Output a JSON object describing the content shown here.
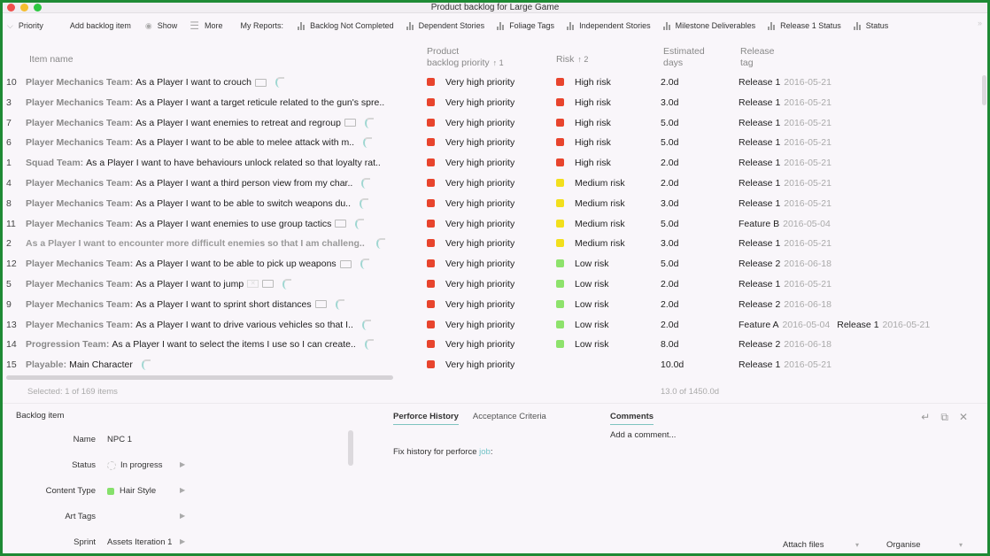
{
  "window": {
    "title": "Product backlog for Large Game"
  },
  "toolbar": {
    "priority_label": "Priority",
    "add_label": "Add backlog item",
    "show_label": "Show",
    "more_label": "More",
    "reports_label": "My Reports:",
    "reports": [
      "Backlog Not Completed",
      "Dependent Stories",
      "Foliage Tags",
      "Independent Stories",
      "Milestone Deliverables",
      "Release 1 Status",
      "Status"
    ],
    "overflow_icon": "double-chevron-right-icon"
  },
  "table": {
    "columns": {
      "name": "Item name",
      "priority_line1": "Product",
      "priority_line2": "backlog priority",
      "priority_sort": "↑ 1",
      "risk": "Risk",
      "risk_sort": "↑ 2",
      "days_line1": "Estimated",
      "days_line2": "days",
      "release_line1": "Release",
      "release_line2": "tag"
    },
    "colors": {
      "very_high": "#e8442d",
      "high_risk": "#e8442d",
      "medium_risk": "#f2df1d",
      "low_risk": "#8ee26c"
    },
    "rows": [
      {
        "num": "10",
        "team": "Player Mechanics Team:",
        "text": "As a Player I want to crouch",
        "icons": [
          "comment",
          "spinner"
        ],
        "priority": "Very high priority",
        "risk": "High risk",
        "risk_level": "high",
        "days": "2.0d",
        "releases": [
          {
            "tag": "Release 1",
            "date": "2016-05-21"
          }
        ]
      },
      {
        "num": "3",
        "team": "Player Mechanics Team:",
        "text": "As a Player I want a target reticule related to the gun's spre..",
        "icons": [],
        "priority": "Very high priority",
        "risk": "High risk",
        "risk_level": "high",
        "days": "3.0d",
        "releases": [
          {
            "tag": "Release 1",
            "date": "2016-05-21"
          }
        ]
      },
      {
        "num": "7",
        "team": "Player Mechanics Team:",
        "text": "As a Player I want enemies to retreat and regroup",
        "icons": [
          "comment",
          "spinner"
        ],
        "priority": "Very high priority",
        "risk": "High risk",
        "risk_level": "high",
        "days": "5.0d",
        "releases": [
          {
            "tag": "Release 1",
            "date": "2016-05-21"
          }
        ]
      },
      {
        "num": "6",
        "team": "Player Mechanics Team:",
        "text": "As a Player I want to be able to melee attack with m..",
        "icons": [
          "spinner"
        ],
        "priority": "Very high priority",
        "risk": "High risk",
        "risk_level": "high",
        "days": "5.0d",
        "releases": [
          {
            "tag": "Release 1",
            "date": "2016-05-21"
          }
        ]
      },
      {
        "num": "1",
        "team": "Squad Team:",
        "text": "As a Player I want to have behaviours unlock related so that loyalty rat..",
        "icons": [],
        "priority": "Very high priority",
        "risk": "High risk",
        "risk_level": "high",
        "days": "2.0d",
        "releases": [
          {
            "tag": "Release 1",
            "date": "2016-05-21"
          }
        ]
      },
      {
        "num": "4",
        "team": "Player Mechanics Team:",
        "text": "As a Player I want a third person view from my char..",
        "icons": [
          "spinner"
        ],
        "priority": "Very high priority",
        "risk": "Medium risk",
        "risk_level": "medium",
        "days": "2.0d",
        "releases": [
          {
            "tag": "Release 1",
            "date": "2016-05-21"
          }
        ]
      },
      {
        "num": "8",
        "team": "Player Mechanics Team:",
        "text": "As a Player I want to be able to switch weapons du..",
        "icons": [
          "spinner"
        ],
        "priority": "Very high priority",
        "risk": "Medium risk",
        "risk_level": "medium",
        "days": "3.0d",
        "releases": [
          {
            "tag": "Release 1",
            "date": "2016-05-21"
          }
        ]
      },
      {
        "num": "11",
        "team": "Player Mechanics Team:",
        "text": "As a Player I want enemies to use group tactics",
        "icons": [
          "comment",
          "spinner"
        ],
        "priority": "Very high priority",
        "risk": "Medium risk",
        "risk_level": "medium",
        "days": "5.0d",
        "releases": [
          {
            "tag": "Feature B",
            "date": "2016-05-04"
          }
        ]
      },
      {
        "num": "2",
        "team": "",
        "text": "As a Player I want to encounter more difficult enemies so that I am challeng..",
        "unassigned": true,
        "icons": [
          "spinner"
        ],
        "priority": "Very high priority",
        "risk": "Medium risk",
        "risk_level": "medium",
        "days": "3.0d",
        "releases": [
          {
            "tag": "Release 1",
            "date": "2016-05-21"
          }
        ]
      },
      {
        "num": "12",
        "team": "Player Mechanics Team:",
        "text": "As a Player I want to be able to pick up weapons",
        "icons": [
          "comment",
          "spinner"
        ],
        "priority": "Very high priority",
        "risk": "Low risk",
        "risk_level": "low",
        "days": "5.0d",
        "releases": [
          {
            "tag": "Release 2",
            "date": "2016-06-18"
          }
        ]
      },
      {
        "num": "5",
        "team": "Player Mechanics Team:",
        "text": "As a Player I want to jump",
        "icons": [
          "mail",
          "comment",
          "spinner"
        ],
        "priority": "Very high priority",
        "risk": "Low risk",
        "risk_level": "low",
        "days": "2.0d",
        "releases": [
          {
            "tag": "Release 1",
            "date": "2016-05-21"
          }
        ]
      },
      {
        "num": "9",
        "team": "Player Mechanics Team:",
        "text": "As a Player I want to sprint short distances",
        "icons": [
          "comment",
          "spinner"
        ],
        "priority": "Very high priority",
        "risk": "Low risk",
        "risk_level": "low",
        "days": "2.0d",
        "releases": [
          {
            "tag": "Release 2",
            "date": "2016-06-18"
          }
        ]
      },
      {
        "num": "13",
        "team": "Player Mechanics Team:",
        "text": "As a Player I want to drive various vehicles so that I..",
        "icons": [
          "spinner"
        ],
        "priority": "Very high priority",
        "risk": "Low risk",
        "risk_level": "low",
        "days": "2.0d",
        "releases": [
          {
            "tag": "Feature A",
            "date": "2016-05-04"
          },
          {
            "tag": "Release 1",
            "date": "2016-05-21"
          }
        ]
      },
      {
        "num": "14",
        "team": "Progression Team:",
        "text": "As a Player I want to select the items I use so I can create..",
        "icons": [
          "spinner"
        ],
        "priority": "Very high priority",
        "risk": "Low risk",
        "risk_level": "low",
        "days": "8.0d",
        "releases": [
          {
            "tag": "Release 2",
            "date": "2016-06-18"
          }
        ]
      },
      {
        "num": "15",
        "team": "Playable:",
        "text": "Main Character",
        "icons": [
          "spinner"
        ],
        "priority": "Very high priority",
        "risk": "",
        "risk_level": "none",
        "days": "10.0d",
        "releases": [
          {
            "tag": "Release 1",
            "date": "2016-05-21"
          }
        ]
      }
    ],
    "footer_selected": "Selected: 1 of 169 items",
    "footer_sum": "13.0 of 1450.0d"
  },
  "detail": {
    "title": "Backlog item",
    "fields": [
      {
        "label": "Name",
        "value": "NPC 1",
        "icon": "",
        "arrow": false
      },
      {
        "label": "Status",
        "value": "In progress",
        "icon": "status-ring",
        "arrow": true
      },
      {
        "label": "Content Type",
        "value": "Hair Style",
        "icon": "color-dot",
        "arrow": true
      },
      {
        "label": "Art Tags",
        "value": "",
        "icon": "",
        "arrow": true
      },
      {
        "label": "Sprint",
        "value": "Assets Iteration 1",
        "icon": "",
        "arrow": true
      }
    ],
    "tabs": [
      "Perforce History",
      "Acceptance Criteria"
    ],
    "active_tab": "Perforce History",
    "fix_history_text": "Fix history for perforce ",
    "fix_history_link": "job",
    "fix_history_suffix": ":",
    "comments_tab": "Comments",
    "add_comment": "Add a comment...",
    "attach_files": "Attach files",
    "organise": "Organise",
    "content_type_color": "#86e06b"
  }
}
